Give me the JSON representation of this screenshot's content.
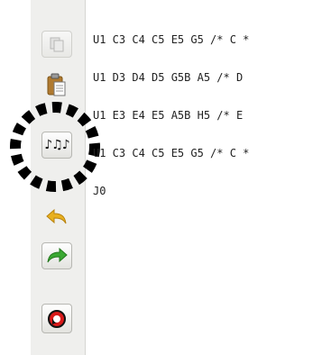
{
  "toolbar": {
    "buttons": [
      {
        "name": "copy-button",
        "icon": "copy-icon",
        "enabled": false
      },
      {
        "name": "paste-button",
        "icon": "paste-icon",
        "enabled": true
      },
      {
        "name": "music-notes-button",
        "icon": "music-notes-icon",
        "glyph": "♪♫♪",
        "enabled": true,
        "highlighted": true
      },
      {
        "name": "undo-button",
        "icon": "undo-arrow-icon",
        "enabled": true
      },
      {
        "name": "redo-button",
        "icon": "redo-arrow-icon",
        "enabled": true
      },
      {
        "name": "refresh-button",
        "icon": "refresh-icon",
        "enabled": true
      }
    ]
  },
  "editor": {
    "lines": [
      "U1 C3 C4 C5 E5 G5 /* C *",
      "U1 D3 D4 D5 G5B A5 /* D",
      "U1 E3 E4 E5 A5B H5 /* E",
      "U1 C3 C4 C5 E5 G5 /* C *",
      "J0"
    ]
  },
  "colors": {
    "toolbar_bg": "#efefed",
    "undo_arrow": "#e8b020",
    "redo_arrow": "#3aa832",
    "paste_clipboard": "#b07a30",
    "refresh_red": "#d81a1a",
    "highlight_ring": "#000000"
  }
}
